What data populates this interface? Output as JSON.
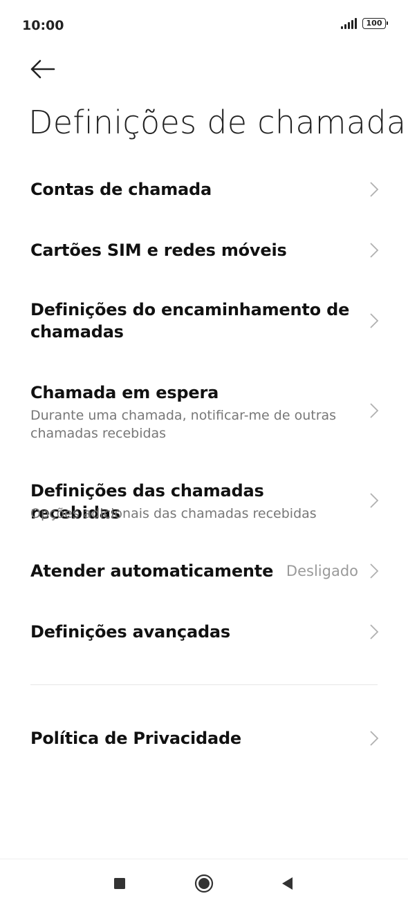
{
  "status_bar": {
    "time": "10:00",
    "signal_icon": "signal-icon",
    "battery_level": "100"
  },
  "header": {
    "back_icon": "back-arrow-icon",
    "title": "Definições de chamada"
  },
  "settings": {
    "items": [
      {
        "title": "Contas de chamada"
      },
      {
        "title": "Cartões SIM e redes móveis"
      },
      {
        "title_line1": "Definições do encaminhamento de",
        "title_line2": "chamadas"
      },
      {
        "title": "Chamada em espera",
        "subtitle_line1": "Durante uma chamada, notificar-me de outras",
        "subtitle_line2": "chamadas recebidas"
      },
      {
        "title": "Definições das chamadas recebidas",
        "subtitle": "Opções adicionais das chamadas recebidas"
      },
      {
        "title": "Atender automaticamente",
        "value": "Desligado"
      },
      {
        "title": "Definições avançadas"
      }
    ],
    "privacy": {
      "title": "Política de Privacidade"
    }
  },
  "nav_bar": {
    "recents_icon": "square-icon",
    "home_icon": "circle-icon",
    "back_icon": "triangle-back-icon"
  },
  "colors": {
    "text_primary": "#111111",
    "text_secondary": "#777777",
    "value_text": "#9a9a9a",
    "chevron": "#b0b0b0",
    "divider": "#e6e6e6"
  }
}
